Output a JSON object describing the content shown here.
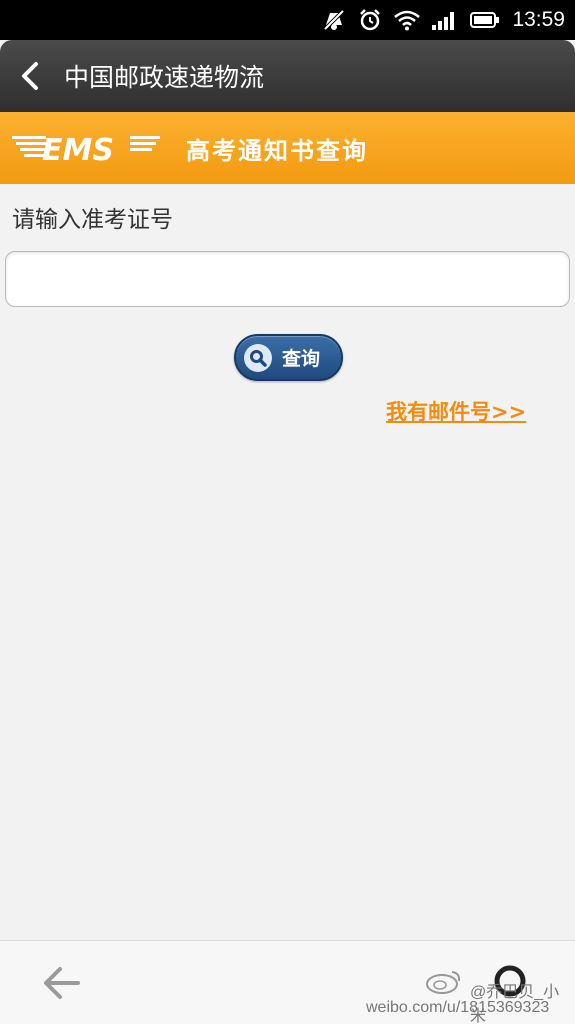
{
  "status_bar": {
    "time": "13:59",
    "icons": [
      "mute-icon",
      "alarm-icon",
      "wifi-icon",
      "signal-icon",
      "battery-icon"
    ]
  },
  "header": {
    "back_icon": "chevron-left-icon",
    "title": "中国邮政速递物流"
  },
  "banner": {
    "logo_text": "EMS",
    "title": "高考通知书查询",
    "color": "#f7a31c"
  },
  "form": {
    "label": "请输入准考证号",
    "input_value": "",
    "input_placeholder": "",
    "query_button_label": "查询",
    "query_icon": "search-icon",
    "button_color": "#2d5d93"
  },
  "links": {
    "mail_number": "我有邮件号>>"
  },
  "bottom_bar": {
    "back_icon": "arrow-left-icon",
    "home_icon": "home-circle-icon"
  },
  "watermark": {
    "name": "@乔巴贝_小米",
    "url": "weibo.com/u/1815369323"
  }
}
